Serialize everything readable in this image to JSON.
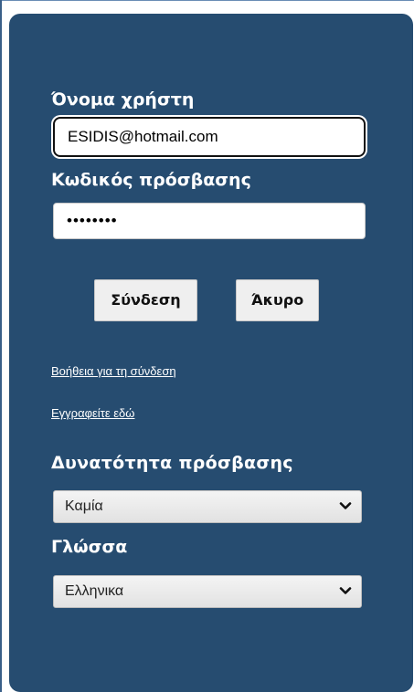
{
  "login_form": {
    "username_label": "Όνομα χρήστη",
    "username_value": "ESIDIS@hotmail.com",
    "password_label": "Κωδικός πρόσβασης",
    "password_value": "••••••••",
    "login_button": "Σύνδεση",
    "cancel_button": "Άκυρο",
    "help_link": "Βοήθεια για τη σύνδεση",
    "register_link": "Εγγραφείτε εδώ",
    "accessibility_label": "Δυνατότητα πρόσβασης",
    "accessibility_selected": "Καμία",
    "language_label": "Γλώσσα",
    "language_selected": "Ελληνικα"
  },
  "colors": {
    "panel_bg": "#264c70",
    "label_text": "#ffffff",
    "button_bg": "#efefef"
  },
  "icons": {
    "dropdown": "chevron-down-icon"
  }
}
